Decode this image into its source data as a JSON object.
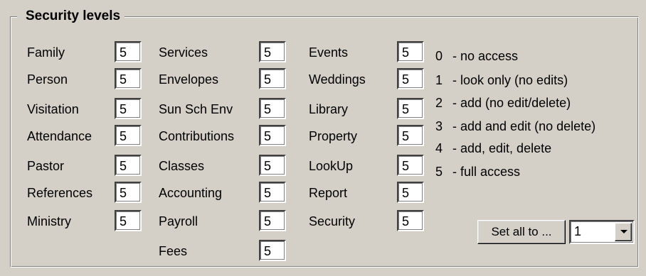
{
  "group": {
    "title": "Security levels"
  },
  "fields": [
    {
      "label": "Family",
      "value": "5"
    },
    {
      "label": "Person",
      "value": "5"
    },
    {
      "label": "Visitation",
      "value": "5"
    },
    {
      "label": "Attendance",
      "value": "5"
    },
    {
      "label": "Pastor",
      "value": "5"
    },
    {
      "label": "References",
      "value": "5"
    },
    {
      "label": "Ministry",
      "value": "5"
    },
    {
      "label": "Services",
      "value": "5"
    },
    {
      "label": "Envelopes",
      "value": "5"
    },
    {
      "label": "Sun Sch Env",
      "value": "5"
    },
    {
      "label": "Contributions",
      "value": "5"
    },
    {
      "label": "Classes",
      "value": "5"
    },
    {
      "label": "Accounting",
      "value": "5"
    },
    {
      "label": "Payroll",
      "value": "5"
    },
    {
      "label": "Fees",
      "value": "5"
    },
    {
      "label": "Events",
      "value": "5"
    },
    {
      "label": "Weddings",
      "value": "5"
    },
    {
      "label": "Library",
      "value": "5"
    },
    {
      "label": "Property",
      "value": "5"
    },
    {
      "label": "LookUp",
      "value": "5"
    },
    {
      "label": "Report",
      "value": "5"
    },
    {
      "label": "Security",
      "value": "5"
    }
  ],
  "legend": [
    {
      "num": "0",
      "text": "- no access"
    },
    {
      "num": "1",
      "text": "- look only (no edits)"
    },
    {
      "num": "2",
      "text": "- add (no edit/delete)"
    },
    {
      "num": "3",
      "text": "- add and edit (no delete)"
    },
    {
      "num": "4",
      "text": "- add, edit, delete"
    },
    {
      "num": "5",
      "text": "- full access"
    }
  ],
  "set_all": {
    "button_label": "Set all to ...",
    "selected_value": "1"
  },
  "icons": {
    "dropdown": "chevron-down-icon"
  }
}
